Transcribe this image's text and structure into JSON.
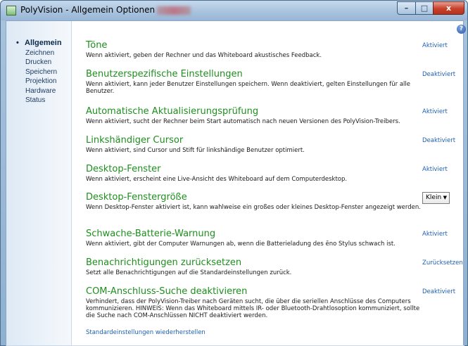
{
  "window": {
    "title": "PolyVision - Allgemein Optionen",
    "controls": {
      "minimize": "–",
      "maximize": "□",
      "close": "x"
    }
  },
  "help_icon": "?",
  "sidebar": {
    "active_marker": "•",
    "items": [
      {
        "label": "Allgemein",
        "active": true
      },
      {
        "label": "Zeichnen",
        "active": false
      },
      {
        "label": "Drucken",
        "active": false
      },
      {
        "label": "Speichern",
        "active": false
      },
      {
        "label": "Projektion",
        "active": false
      },
      {
        "label": "Hardware",
        "active": false
      },
      {
        "label": "Status",
        "active": false
      }
    ]
  },
  "settings": [
    {
      "title": "Töne",
      "description": "Wenn aktiviert, geben der Rechner und das Whiteboard akustisches Feedback.",
      "state": "Aktiviert"
    },
    {
      "title": "Benutzerspezifische Einstellungen",
      "description": "Wenn aktiviert, kann jeder Benutzer Einstellungen speichern. Wenn deaktiviert, gelten Einstellungen für alle Benutzer.",
      "state": "Deaktiviert"
    },
    {
      "title": "Automatische Aktualisierungsprüfung",
      "description": "Wenn aktiviert, sucht der Rechner beim Start automatisch nach neuen Versionen des PolyVision-Treibers.",
      "state": "Aktiviert"
    },
    {
      "title": "Linkshändiger Cursor",
      "description": "Wenn aktiviert, sind Cursor und Stift für linkshändige Benutzer optimiert.",
      "state": "Deaktiviert"
    },
    {
      "title": "Desktop-Fenster",
      "description": "Wenn aktiviert, erscheint eine Live-Ansicht des Whiteboard auf dem Computerdesktop.",
      "state": "Aktiviert"
    },
    {
      "title": "Desktop-Fenstergröße",
      "description": "Wenn Desktop-Fenster aktiviert ist, kann wahlweise ein großes oder kleines Desktop-Fenster angezeigt werden.",
      "dropdown_value": "Klein"
    },
    {
      "title": "Schwache-Batterie-Warnung",
      "description": "Wenn aktiviert, gibt der Computer Warnungen ab, wenn die Batterieladung des ēno Stylus schwach ist.",
      "state": "Aktiviert"
    },
    {
      "title": "Benachrichtigungen zurücksetzen",
      "description": "Setzt alle Benachrichtigungen auf die Standardeinstellungen zurück.",
      "state": "Zurücksetzen"
    },
    {
      "title": "COM-Anschluss-Suche deaktivieren",
      "description": "Verhindert, dass der PolyVision-Treiber nach Geräten sucht, die über die seriellen Anschlüsse des Computers kommunizieren. HINWEIS: Wenn das Whiteboard mittels IR- oder Bluetooth-Drahtlosoption kommuniziert, sollte die Suche nach COM-Anschlüssen NICHT deaktiviert werden.",
      "state": "Deaktiviert"
    }
  ],
  "footer": {
    "restore_defaults": "Standardeinstellungen wiederherstellen"
  },
  "colors": {
    "heading": "#1e8f1e",
    "link": "#1d5fb5",
    "sidebar_text": "#1e3a5f"
  }
}
